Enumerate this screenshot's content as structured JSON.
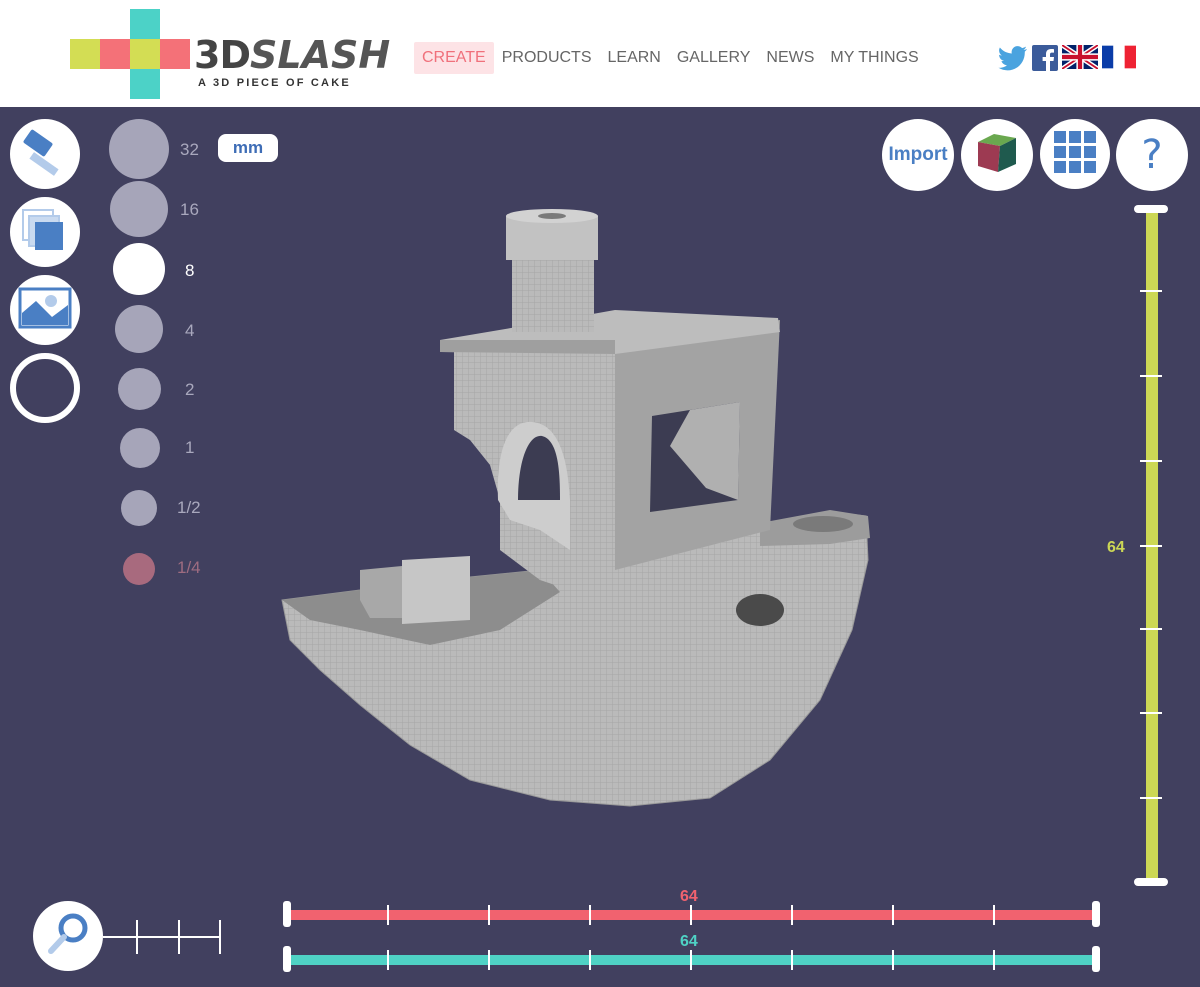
{
  "header": {
    "brand_main": "3D",
    "brand_accent": "SLASH",
    "tagline": "A 3D PIECE OF CAKE",
    "logo_colors": [
      "#d3dd54",
      "#f47178",
      "#f47178",
      "#4cd2c7",
      "#d3dd54"
    ],
    "nav": [
      {
        "label": "CREATE",
        "active": true
      },
      {
        "label": "PRODUCTS",
        "active": false
      },
      {
        "label": "LEARN",
        "active": false
      },
      {
        "label": "GALLERY",
        "active": false
      },
      {
        "label": "NEWS",
        "active": false
      },
      {
        "label": "MY THINGS",
        "active": false
      }
    ],
    "social_icons": [
      "twitter-icon",
      "facebook-icon",
      "uk-flag-icon",
      "france-flag-icon"
    ]
  },
  "tools": {
    "left_icons": [
      "hammer-icon",
      "cube-layers-icon",
      "image-icon",
      "circle-tool-icon"
    ],
    "size_labels": [
      "32",
      "16",
      "8",
      "4",
      "2",
      "1",
      "1/2",
      "1/4"
    ],
    "selected_size": "8",
    "unit": "mm"
  },
  "top_right": {
    "import_label": "Import",
    "cube_icon": "color-cube-icon",
    "grid_icon": "grid-icon",
    "help_label": "?"
  },
  "dimensions": {
    "z_value": "64",
    "x_value": "64",
    "y_value": "64"
  },
  "colors": {
    "background": "#41405f",
    "z_axis": "#ccd755",
    "x_axis": "#f1626f",
    "y_axis": "#4fd2c5",
    "model": "#b8b8b8",
    "accent_blue": "#4a7fc4"
  },
  "zoom": {
    "icon": "magnifier-icon"
  }
}
